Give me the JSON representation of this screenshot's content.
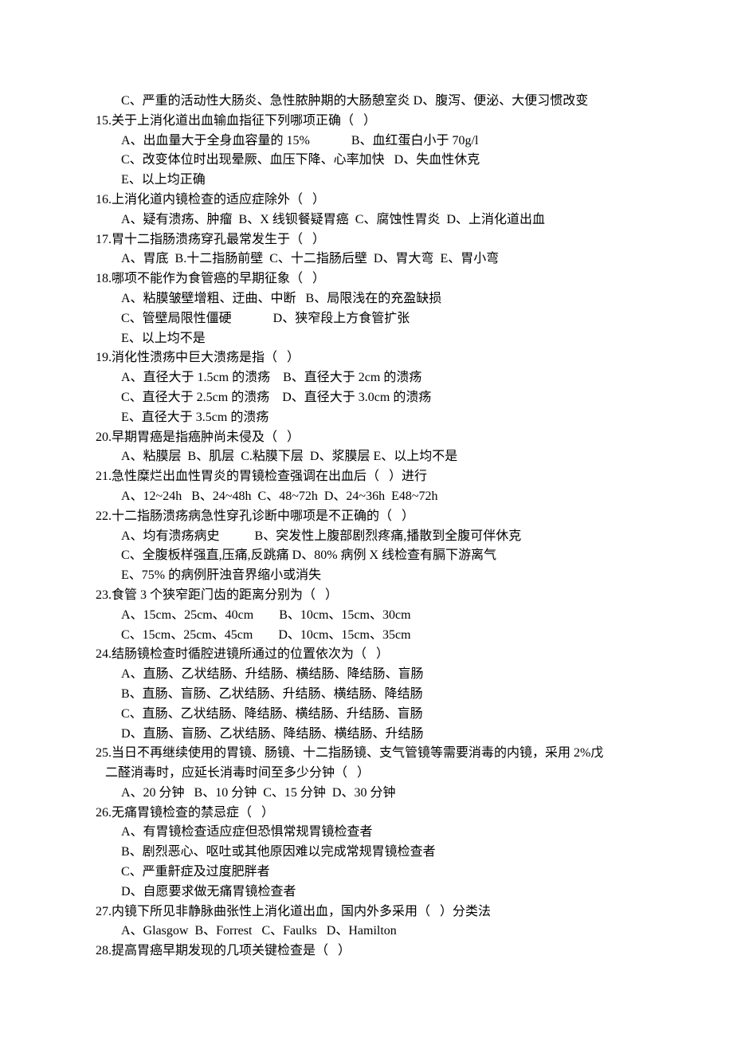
{
  "lines": [
    {
      "cls": "option",
      "text": "C、严重的活动性大肠炎、急性脓肿期的大肠憩室炎 D、腹泻、便泌、大便习惯改变"
    },
    {
      "cls": "question",
      "text": "15.关于上消化道出血输血指征下列哪项正确（   ）"
    },
    {
      "cls": "option",
      "text": "A、出血量大于全身血容量的 15%             B、血红蛋白小于 70g/l"
    },
    {
      "cls": "option",
      "text": "C、改变体位时出现晕厥、血压下降、心率加快   D、失血性休克"
    },
    {
      "cls": "option",
      "text": "E、以上均正确"
    },
    {
      "cls": "question",
      "text": "16.上消化道内镜检查的适应症除外（   ）"
    },
    {
      "cls": "option",
      "text": "A、疑有溃疡、肿瘤  B、X 线钡餐疑胃癌  C、腐蚀性胃炎  D、上消化道出血"
    },
    {
      "cls": "question",
      "text": "17.胃十二指肠溃疡穿孔最常发生于（   ）"
    },
    {
      "cls": "option",
      "text": "A、胃底  B.十二指肠前壁  C、十二指肠后壁  D、胃大弯  E、胃小弯"
    },
    {
      "cls": "question",
      "text": "18.哪项不能作为食管癌的早期征象（   ）"
    },
    {
      "cls": "option",
      "text": "A、粘膜皱壁增粗、迂曲、中断   B、局限浅在的充盈缺损"
    },
    {
      "cls": "option",
      "text": "C、管壁局限性僵硬             D、狭窄段上方食管扩张"
    },
    {
      "cls": "option",
      "text": "E、以上均不是"
    },
    {
      "cls": "question",
      "text": "19.消化性溃疡中巨大溃疡是指（   ）"
    },
    {
      "cls": "option",
      "text": "A、直径大于 1.5cm 的溃疡    B、直径大于 2cm 的溃疡"
    },
    {
      "cls": "option",
      "text": "C、直径大于 2.5cm 的溃疡    D、直径大于 3.0cm 的溃疡"
    },
    {
      "cls": "option",
      "text": "E、直径大于 3.5cm 的溃疡"
    },
    {
      "cls": "question",
      "text": "20.早期胃癌是指癌肿尚未侵及（   ）"
    },
    {
      "cls": "option",
      "text": "A、粘膜层  B、肌层  C.粘膜下层  D、浆膜层 E、以上均不是"
    },
    {
      "cls": "question",
      "text": "21.急性糜烂出血性胃炎的胃镜检查强调在出血后（   ）进行"
    },
    {
      "cls": "option",
      "text": "A、12~24h   B、24~48h  C、48~72h  D、24~36h  E48~72h"
    },
    {
      "cls": "question",
      "text": "22.十二指肠溃疡病急性穿孔诊断中哪项是不正确的（   ）"
    },
    {
      "cls": "option",
      "text": "A、均有溃疡病史           B、突发性上腹部剧烈疼痛,播散到全腹可伴休克"
    },
    {
      "cls": "option",
      "text": "C、全腹板样强直,压痛,反跳痛 D、80% 病例 X 线检查有膈下游离气"
    },
    {
      "cls": "option",
      "text": "E、75% 的病例肝浊音界缩小或消失"
    },
    {
      "cls": "question",
      "text": "23.食管 3 个狭窄距门齿的距离分别为（   ）"
    },
    {
      "cls": "option",
      "text": "A、15cm、25cm、40cm        B、10cm、15cm、30cm"
    },
    {
      "cls": "option",
      "text": "C、15cm、25cm、45cm        D、10cm、15cm、35cm"
    },
    {
      "cls": "question",
      "text": "24.结肠镜检查时循腔进镜所通过的位置依次为（   ）"
    },
    {
      "cls": "option",
      "text": "A、直肠、乙状结肠、升结肠、横结肠、降结肠、盲肠"
    },
    {
      "cls": "option",
      "text": "B、直肠、盲肠、乙状结肠、升结肠、横结肠、降结肠"
    },
    {
      "cls": "option",
      "text": "C、直肠、乙状结肠、降结肠、横结肠、升结肠、盲肠"
    },
    {
      "cls": "option",
      "text": "D、直肠、盲肠、乙状结肠、降结肠、横结肠、升结肠"
    },
    {
      "cls": "question",
      "text": "25.当日不再继续使用的胃镜、肠镜、十二指肠镜、支气管镜等需要消毒的内镜，采用 2%戊"
    },
    {
      "cls": "question",
      "text": "   二醛消毒时，应延长消毒时间至多少分钟（   ）"
    },
    {
      "cls": "option",
      "text": "A、20 分钟   B、10 分钟  C、15 分钟  D、30 分钟"
    },
    {
      "cls": "question",
      "text": "26.无痛胃镜检查的禁忌症（   ）"
    },
    {
      "cls": "option",
      "text": "A、有胃镜检查适应症但恐惧常规胃镜检查者"
    },
    {
      "cls": "option",
      "text": "B、剧烈恶心、呕吐或其他原因难以完成常规胃镜检查者"
    },
    {
      "cls": "option",
      "text": "C、严重鼾症及过度肥胖者"
    },
    {
      "cls": "option",
      "text": "D、自愿要求做无痛胃镜检查者"
    },
    {
      "cls": "question",
      "text": "27.内镜下所见非静脉曲张性上消化道出血，国内外多采用（   ）分类法"
    },
    {
      "cls": "option",
      "text": "A、Glasgow  B、Forrest   C、Faulks   D、Hamilton"
    },
    {
      "cls": "question",
      "text": "28.提高胃癌早期发现的几项关键检查是（   ）"
    }
  ]
}
